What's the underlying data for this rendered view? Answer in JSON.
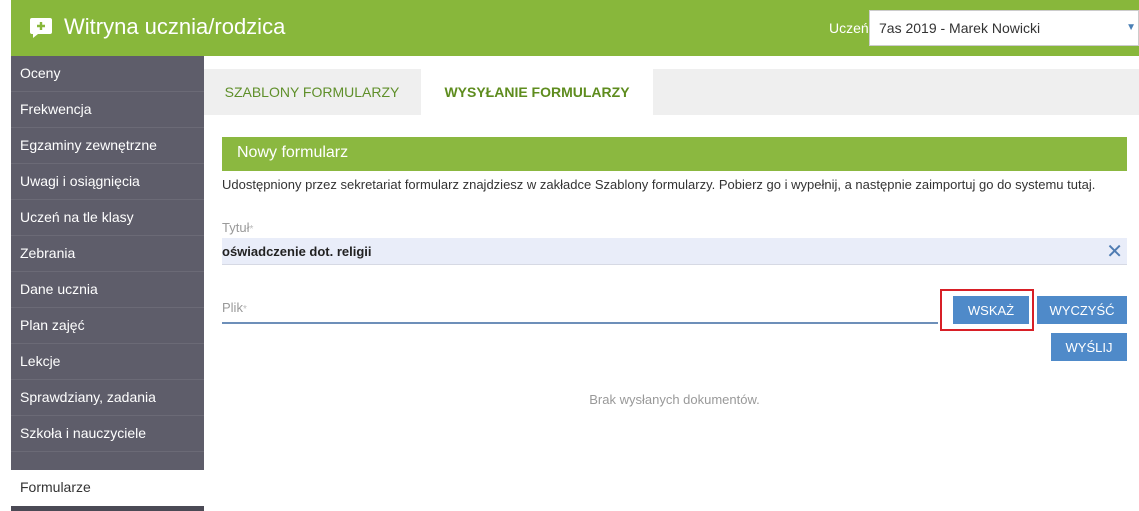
{
  "header": {
    "title": "Witryna ucznia/rodzica",
    "logo_icon": "chat-plus-icon",
    "student_label": "Uczeń:",
    "student_value": "7as 2019 - Marek Nowicki",
    "accent_color": "#88b73b"
  },
  "sidebar": {
    "items": [
      {
        "label": "Oceny"
      },
      {
        "label": "Frekwencja"
      },
      {
        "label": "Egzaminy zewnętrzne"
      },
      {
        "label": "Uwagi i osiągnięcia"
      },
      {
        "label": "Uczeń na tle klasy"
      },
      {
        "label": "Zebrania"
      },
      {
        "label": "Dane ucznia"
      },
      {
        "label": "Plan zajęć"
      },
      {
        "label": "Lekcje"
      },
      {
        "label": "Sprawdziany, zadania"
      },
      {
        "label": "Szkoła i nauczyciele"
      },
      {
        "label": "Formularze",
        "active": true
      }
    ]
  },
  "tabs": [
    {
      "label": "SZABLONY FORMULARZY"
    },
    {
      "label": "WYSYŁANIE FORMULARZY",
      "active": true
    }
  ],
  "panel": {
    "heading": "Nowy formularz",
    "info": "Udostępniony przez sekretariat formularz znajdziesz w zakładce Szablony formularzy. Pobierz go i wypełnij, a następnie zaimportuj go do systemu tutaj.",
    "title_label": "Tytuł",
    "required_mark": "*",
    "title_value": "oświadczenie dot. religii",
    "clear_icon": "close-icon",
    "file_label": "Plik",
    "buttons": {
      "pick": "WSKAŻ",
      "clear": "WYCZYŚĆ",
      "send": "WYŚLIJ"
    },
    "empty_message": "Brak wysłanych dokumentów."
  }
}
